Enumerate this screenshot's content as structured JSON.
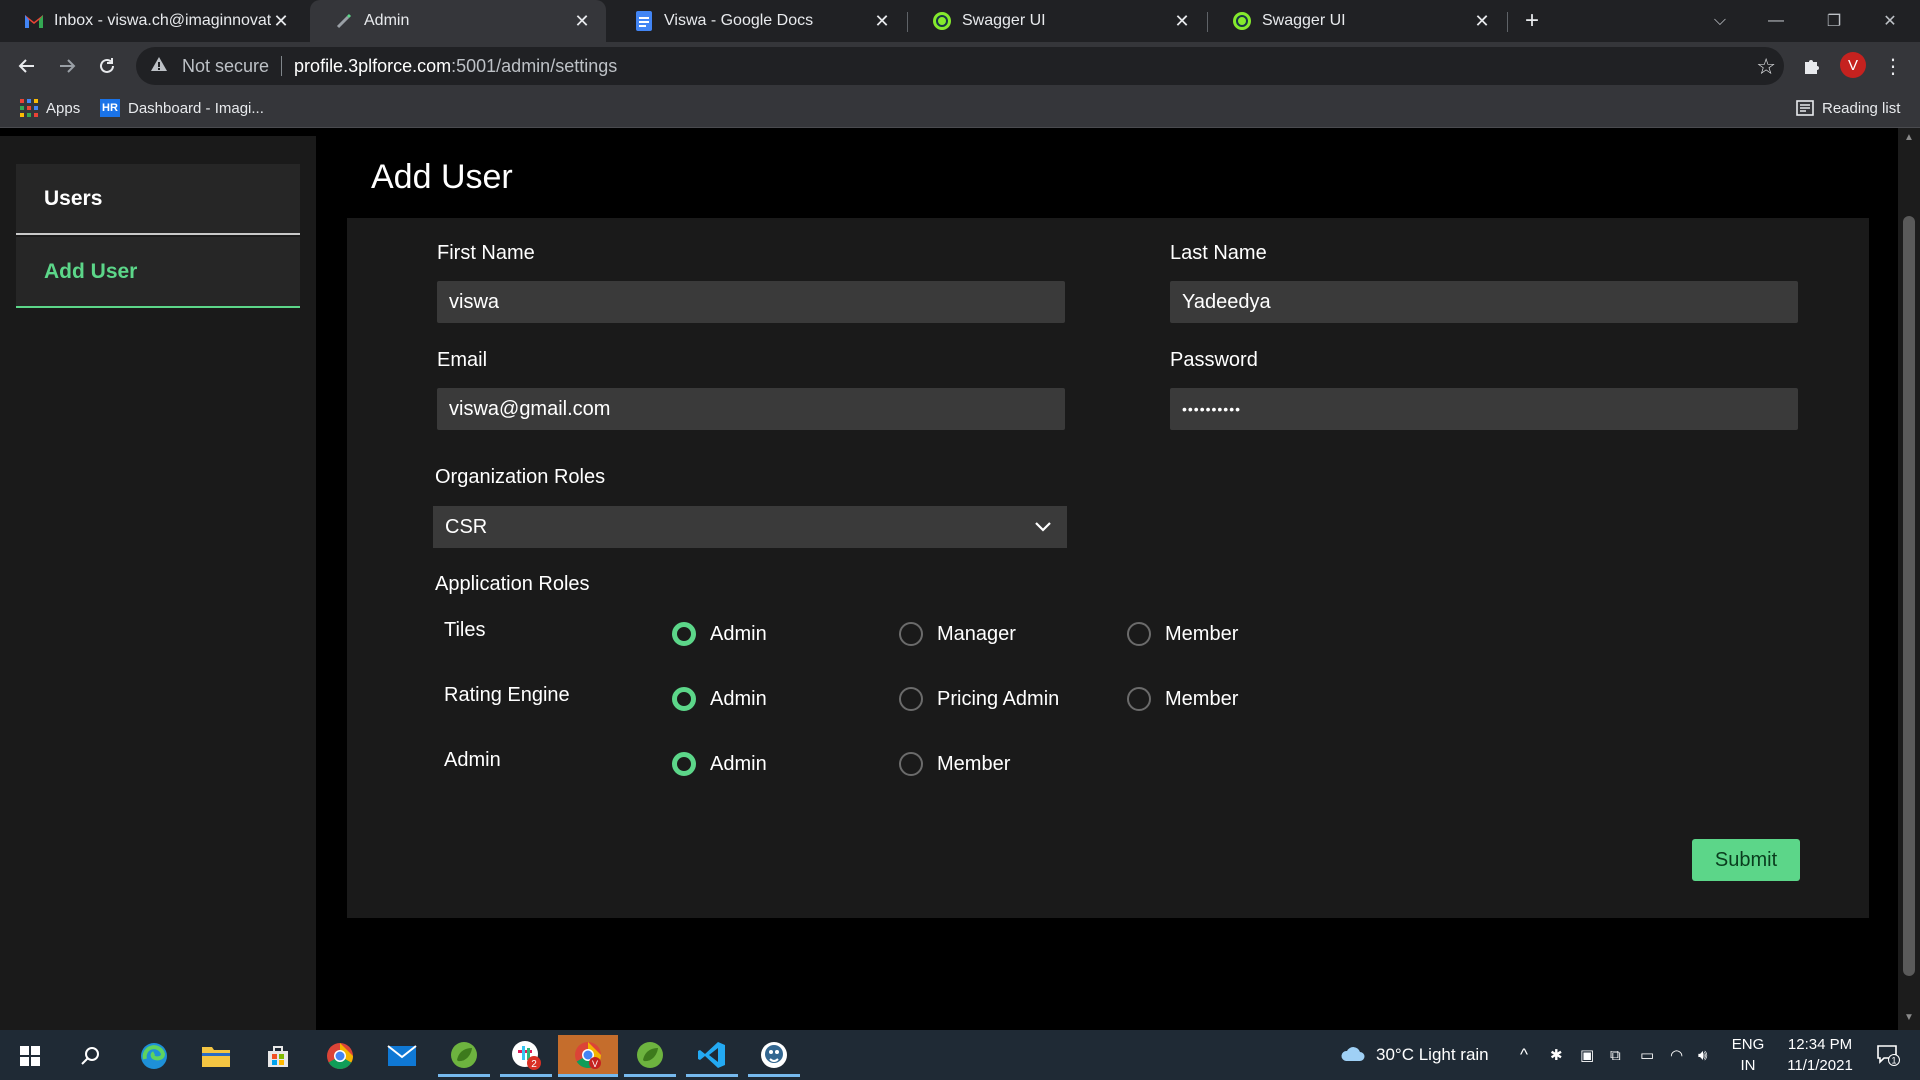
{
  "browser": {
    "tabs": [
      {
        "title": "Inbox - viswa.ch@imaginnovate.c",
        "icon": "gmail-icon"
      },
      {
        "title": "Admin",
        "icon": "pen-icon",
        "active": true
      },
      {
        "title": "Viswa - Google Docs",
        "icon": "docs-icon"
      },
      {
        "title": "Swagger UI",
        "icon": "swagger-icon"
      },
      {
        "title": "Swagger UI",
        "icon": "swagger-icon"
      }
    ],
    "address": {
      "security": "Not secure",
      "host": "profile.3plforce.com",
      "path": ":5001/admin/settings"
    },
    "profile_initial": "V",
    "bookmarks": {
      "apps": "Apps",
      "hr_badge": "HR",
      "dashboard": "Dashboard - Imagi...",
      "reading_list": "Reading list"
    }
  },
  "sidebar": {
    "items": [
      {
        "label": "Users",
        "active": false
      },
      {
        "label": "Add User",
        "active": true
      }
    ]
  },
  "page": {
    "title": "Add User"
  },
  "form": {
    "first_name": {
      "label": "First Name",
      "value": "viswa"
    },
    "last_name": {
      "label": "Last Name",
      "value": "Yadeedya"
    },
    "email": {
      "label": "Email",
      "value": "viswa@gmail.com"
    },
    "password": {
      "label": "Password",
      "value": "••••••••••"
    },
    "org_roles": {
      "label": "Organization Roles",
      "selected": "CSR"
    },
    "app_roles": {
      "label": "Application Roles",
      "rows": [
        {
          "name": "Tiles",
          "options": [
            "Admin",
            "Manager",
            "Member"
          ],
          "selected": "Admin"
        },
        {
          "name": "Rating Engine",
          "options": [
            "Admin",
            "Pricing Admin",
            "Member"
          ],
          "selected": "Admin"
        },
        {
          "name": "Admin",
          "options": [
            "Admin",
            "Member"
          ],
          "selected": "Admin"
        }
      ]
    },
    "submit_label": "Submit"
  },
  "taskbar": {
    "weather": "30°C  Light rain",
    "lang_top": "ENG",
    "lang_bottom": "IN",
    "time": "12:34 PM",
    "date": "11/1/2021",
    "notification_count": "1",
    "badge_count": "2"
  },
  "colors": {
    "accent": "#5cd689",
    "panel": "#1a1a1a",
    "input": "#3a3a3a"
  }
}
